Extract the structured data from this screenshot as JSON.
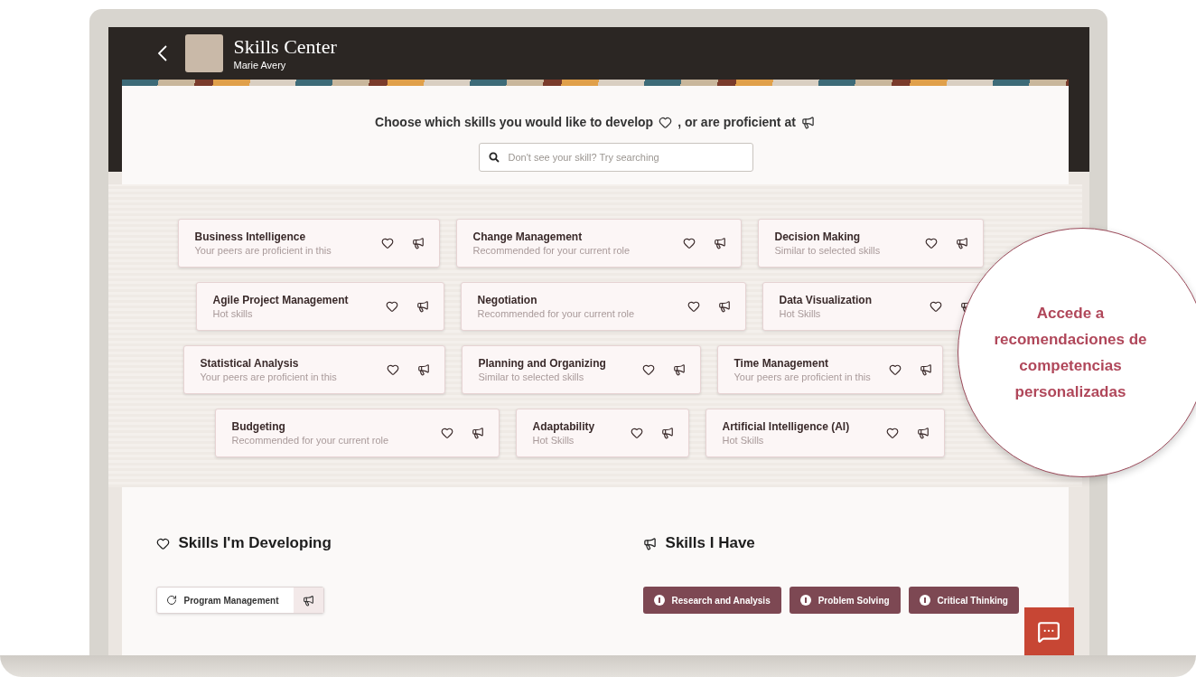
{
  "header": {
    "title": "Skills Center",
    "user_name": "Marie Avery"
  },
  "prompt": {
    "develop_text": "Choose which skills you would like to develop",
    "proficient_text": ", or are proficient at"
  },
  "search": {
    "placeholder": "Don't see your skill? Try searching"
  },
  "skill_rows": [
    {
      "cards": [
        {
          "name": "Business Intelligence",
          "reason": "Your peers are proficient in this"
        },
        {
          "name": "Change Management",
          "reason": "Recommended for your current role"
        },
        {
          "name": "Decision Making",
          "reason": "Similar to selected skills"
        }
      ]
    },
    {
      "cards": [
        {
          "name": "Agile Project Management",
          "reason": "Hot skills"
        },
        {
          "name": "Negotiation",
          "reason": "Recommended for your current role"
        },
        {
          "name": "Data Visualization",
          "reason": "Hot Skills"
        }
      ]
    },
    {
      "cards": [
        {
          "name": "Statistical Analysis",
          "reason": "Your peers are proficient in this"
        },
        {
          "name": "Planning and Organizing",
          "reason": "Similar to selected skills"
        },
        {
          "name": "Time Management",
          "reason": "Your peers are proficient in this"
        }
      ]
    },
    {
      "cards": [
        {
          "name": "Budgeting",
          "reason": "Recommended for your current role"
        },
        {
          "name": "Adaptability",
          "reason": "Hot Skills"
        },
        {
          "name": "Artificial Intelligence (AI)",
          "reason": "Hot Skills"
        }
      ]
    }
  ],
  "developing": {
    "title": "Skills I'm Developing",
    "items": [
      {
        "name": "Program Management"
      }
    ]
  },
  "have": {
    "title": "Skills I Have",
    "items": [
      {
        "name": "Research and Analysis"
      },
      {
        "name": "Problem Solving"
      },
      {
        "name": "Critical Thinking"
      }
    ]
  },
  "callout": {
    "text": "Accede a recomendaciones de competencias personalizadas"
  }
}
